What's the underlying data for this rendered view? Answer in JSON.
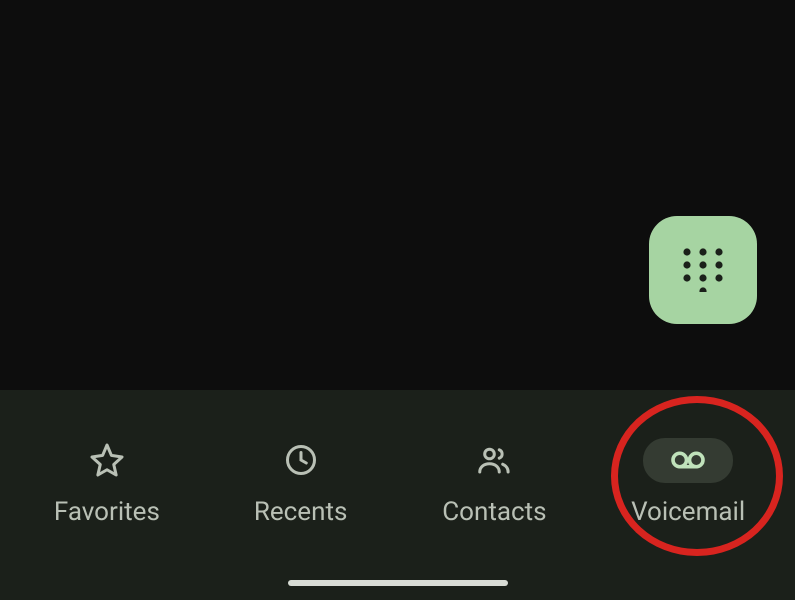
{
  "fab": {
    "name": "dialpad-button",
    "icon": "dialpad-icon"
  },
  "nav": {
    "items": [
      {
        "key": "favorites",
        "label": "Favorites",
        "icon": "star-icon",
        "active": false
      },
      {
        "key": "recents",
        "label": "Recents",
        "icon": "clock-icon",
        "active": false
      },
      {
        "key": "contacts",
        "label": "Contacts",
        "icon": "people-icon",
        "active": false
      },
      {
        "key": "voicemail",
        "label": "Voicemail",
        "icon": "voicemail-icon",
        "active": true
      }
    ]
  },
  "colors": {
    "accent": "#a6d4a2",
    "nav_bg": "#1b201a",
    "nav_active_bg": "#343b32",
    "highlight": "#d8241f"
  }
}
